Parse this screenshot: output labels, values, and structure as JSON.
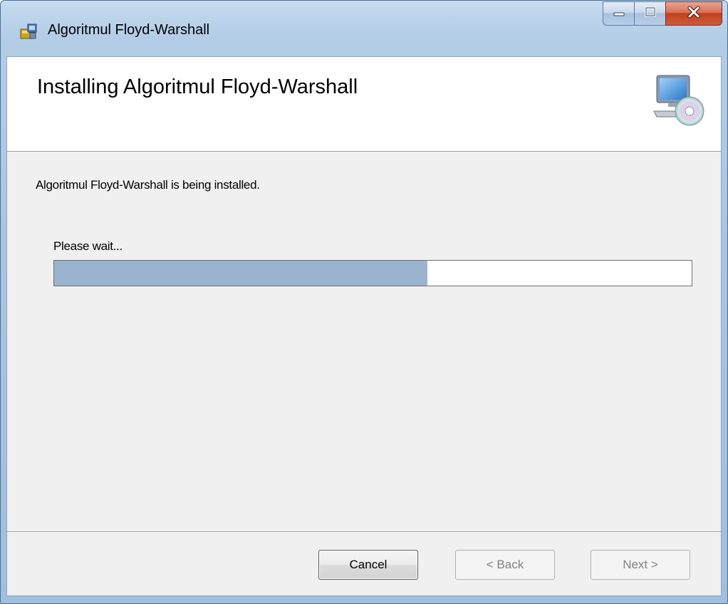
{
  "window": {
    "title": "Algoritmul Floyd-Warshall",
    "controls": [
      "minimize-icon",
      "maximize-icon",
      "close-icon"
    ]
  },
  "banner": {
    "heading": "Installing Algoritmul Floyd-Warshall",
    "icon": "computer-cd-icon"
  },
  "body": {
    "status": "Algoritmul Floyd-Warshall is being installed.",
    "wait_label": "Please wait...",
    "progress_percent": 58.5
  },
  "buttons": {
    "cancel": "Cancel",
    "back": "< Back",
    "next": "Next >"
  },
  "colors": {
    "progress_fill": "#9ab3cf",
    "client_bg": "#f0f0f0",
    "close_button": "#c2401f"
  }
}
